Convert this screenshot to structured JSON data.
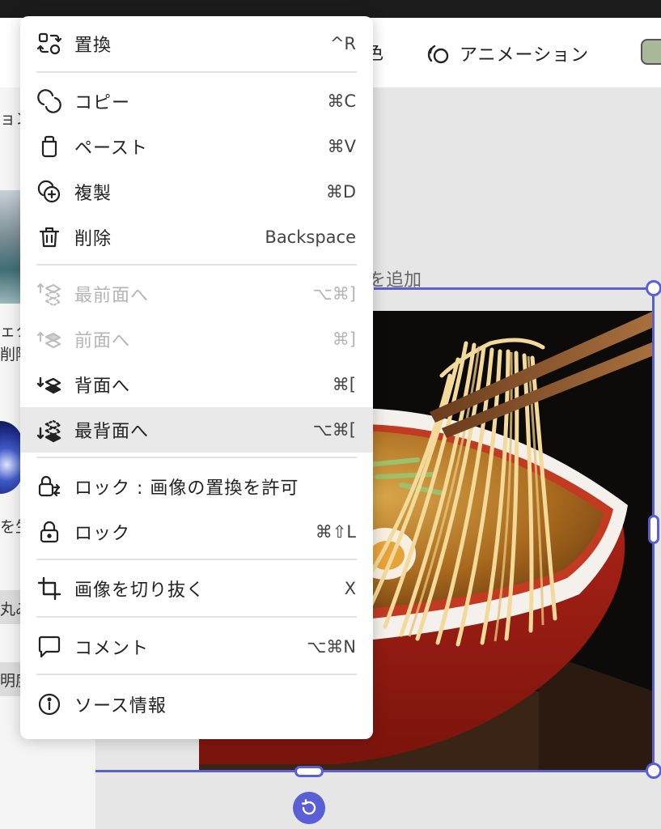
{
  "toolbar": {
    "partial_label": "色",
    "animation_label": "アニメーション",
    "swatch_color": "#a9b79a"
  },
  "left_panel": {
    "partial_texts": [
      "ョン",
      "ェク",
      "削除",
      "を生",
      "丸み",
      "明度"
    ]
  },
  "canvas": {
    "add_text": "を追加",
    "selection_color": "#5b5fd6"
  },
  "menu": {
    "items": [
      {
        "label": "置換",
        "shortcut": "^R",
        "icon": "replace-icon",
        "disabled": false
      },
      {
        "label": "コピー",
        "shortcut": "⌘C",
        "icon": "copy-icon",
        "disabled": false
      },
      {
        "label": "ペースト",
        "shortcut": "⌘V",
        "icon": "paste-icon",
        "disabled": false
      },
      {
        "label": "複製",
        "shortcut": "⌘D",
        "icon": "duplicate-icon",
        "disabled": false
      },
      {
        "label": "削除",
        "shortcut": "Backspace",
        "icon": "trash-icon",
        "disabled": false
      },
      {
        "label": "最前面へ",
        "shortcut": "⌥⌘]",
        "icon": "bring-to-front-icon",
        "disabled": true
      },
      {
        "label": "前面へ",
        "shortcut": "⌘]",
        "icon": "bring-forward-icon",
        "disabled": true
      },
      {
        "label": "背面へ",
        "shortcut": "⌘[",
        "icon": "send-backward-icon",
        "disabled": false
      },
      {
        "label": "最背面へ",
        "shortcut": "⌥⌘[",
        "icon": "send-to-back-icon",
        "disabled": false,
        "highlighted": true
      },
      {
        "label": "ロック : 画像の置換を許可",
        "shortcut": "",
        "icon": "lock-replace-icon",
        "disabled": false
      },
      {
        "label": "ロック",
        "shortcut": "⌘⇧L",
        "icon": "lock-icon",
        "disabled": false
      },
      {
        "label": "画像を切り抜く",
        "shortcut": "X",
        "icon": "crop-icon",
        "disabled": false
      },
      {
        "label": "コメント",
        "shortcut": "⌥⌘N",
        "icon": "comment-icon",
        "disabled": false
      },
      {
        "label": "ソース情報",
        "shortcut": "",
        "icon": "info-icon",
        "disabled": false
      }
    ]
  }
}
